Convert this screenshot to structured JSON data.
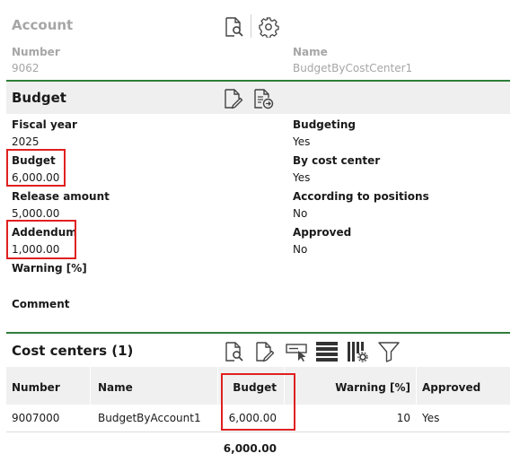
{
  "account": {
    "title": "Account",
    "number_label": "Number",
    "number_value": "9062",
    "name_label": "Name",
    "name_value": "BudgetByCostCenter1",
    "icons": [
      "search-document-icon",
      "gear-icon"
    ]
  },
  "budget": {
    "title": "Budget",
    "icons": [
      "edit-document-icon",
      "export-document-icon"
    ],
    "fiscal_year_label": "Fiscal year",
    "fiscal_year_value": "2025",
    "budget_label": "Budget",
    "budget_value": "6,000.00",
    "release_amount_label": "Release amount",
    "release_amount_value": "5,000.00",
    "addendum_label": "Addendum",
    "addendum_value": "1,000.00",
    "warning_label": "Warning [%]",
    "warning_value": "",
    "comment_label": "Comment",
    "comment_value": "",
    "budgeting_label": "Budgeting",
    "budgeting_value": "Yes",
    "by_cost_center_label": "By cost center",
    "by_cost_center_value": "Yes",
    "according_label": "According to positions",
    "according_value": "No",
    "approved_label": "Approved",
    "approved_value": "No"
  },
  "cost_centers": {
    "title": "Cost centers (1)",
    "icons": [
      "search-document-icon",
      "edit-document-icon",
      "select-row-icon",
      "list-lines-icon",
      "column-settings-icon",
      "filter-icon"
    ],
    "columns": [
      "Number",
      "Name",
      "Budget",
      "Warning [%]",
      "Approved"
    ],
    "rows": [
      {
        "number": "9007000",
        "name": "BudgetByAccount1",
        "budget": "6,000.00",
        "warning": "10",
        "approved": "Yes"
      }
    ],
    "total_budget": "6,000.00"
  },
  "colors": {
    "accent_green": "#2f7d3a",
    "highlight_red": "#e02020",
    "muted_text": "#a6a6a6"
  }
}
